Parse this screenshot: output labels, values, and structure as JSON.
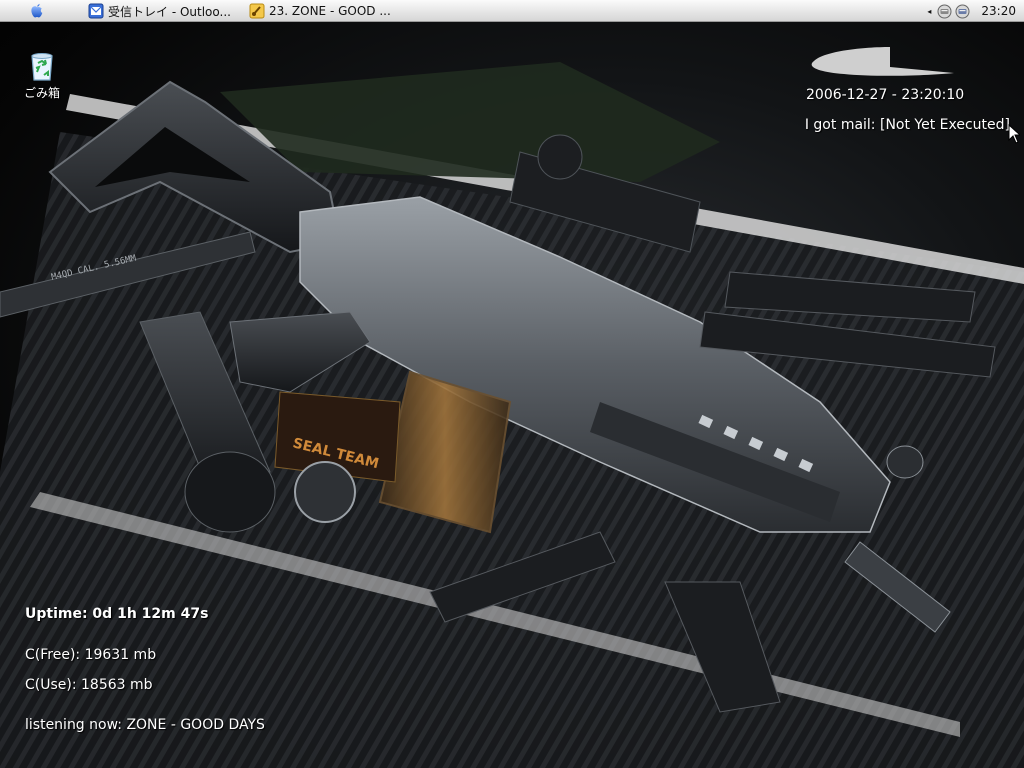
{
  "menubar": {
    "tasks": [
      {
        "label": "受信トレイ - Outloo...",
        "icon": "outlook-icon"
      },
      {
        "label": "23. ZONE - GOOD ...",
        "icon": "music-player-icon"
      }
    ],
    "tray": {
      "arrow": "◂",
      "clock": "23:20"
    }
  },
  "desktop": {
    "trash_label": "ごみ箱"
  },
  "desklets": {
    "datetime": "2006-12-27 - 23:20:10",
    "mail": "I got mail: [Not Yet Executed]",
    "uptime": "Uptime: 0d 1h 12m 47s",
    "c_free": "C(Free): 19631 mb",
    "c_use": "C(Use): 18563 mb",
    "listening": "listening now: ZONE - GOOD DAYS"
  },
  "wallpaper": {
    "rifle_text": "M4QD  CAL. 5.56MM",
    "patch_text": "SEAL TEAM"
  },
  "colors": {
    "menubar_top": "#fbfbfb",
    "menubar_bottom": "#d6d6d6",
    "desktop_text": "#ffffff",
    "blob": "#cfcfcf"
  }
}
